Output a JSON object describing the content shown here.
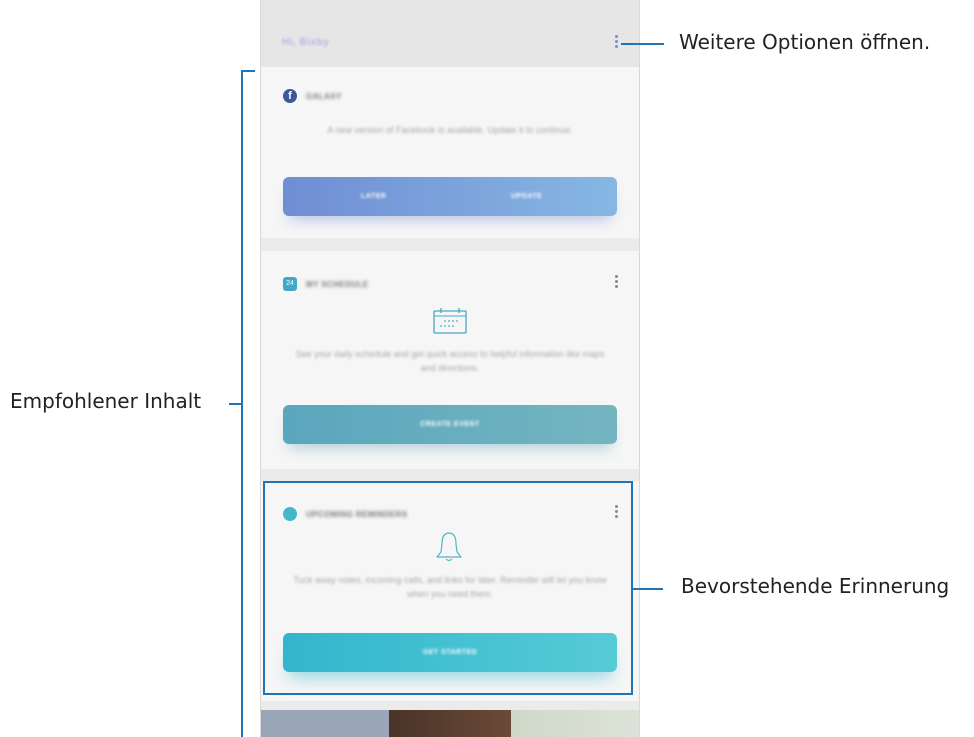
{
  "callouts": {
    "more_options": "Weitere Optionen öffnen.",
    "recommended_content": "Empfohlener Inhalt",
    "upcoming_reminder": "Bevorstehende Erinnerung"
  },
  "app": {
    "title": "Hi, Bixby",
    "menu_icon": "more-vert-icon"
  },
  "cards": [
    {
      "icon": "facebook-icon",
      "icon_glyph": "f",
      "title": "GALAXY",
      "description": "A new version of Facebook is available. Update it to continue.",
      "buttons": [
        "LATER",
        "UPDATE"
      ]
    },
    {
      "icon": "calendar-icon",
      "icon_glyph": "24",
      "title": "MY SCHEDULE",
      "description": "See your daily schedule and get quick access to helpful information like maps and directions.",
      "buttons": [
        "CREATE EVENT"
      ]
    },
    {
      "icon": "reminder-icon",
      "title": "UPCOMING REMINDERS",
      "description": "Tuck away notes, incoming calls, and links for later. Reminder will let you know when you need them.",
      "buttons": [
        "GET STARTED"
      ]
    }
  ],
  "colors": {
    "annotation": "#1f73b7",
    "facebook": "#3b5998",
    "accent": "#8b7fe0"
  }
}
